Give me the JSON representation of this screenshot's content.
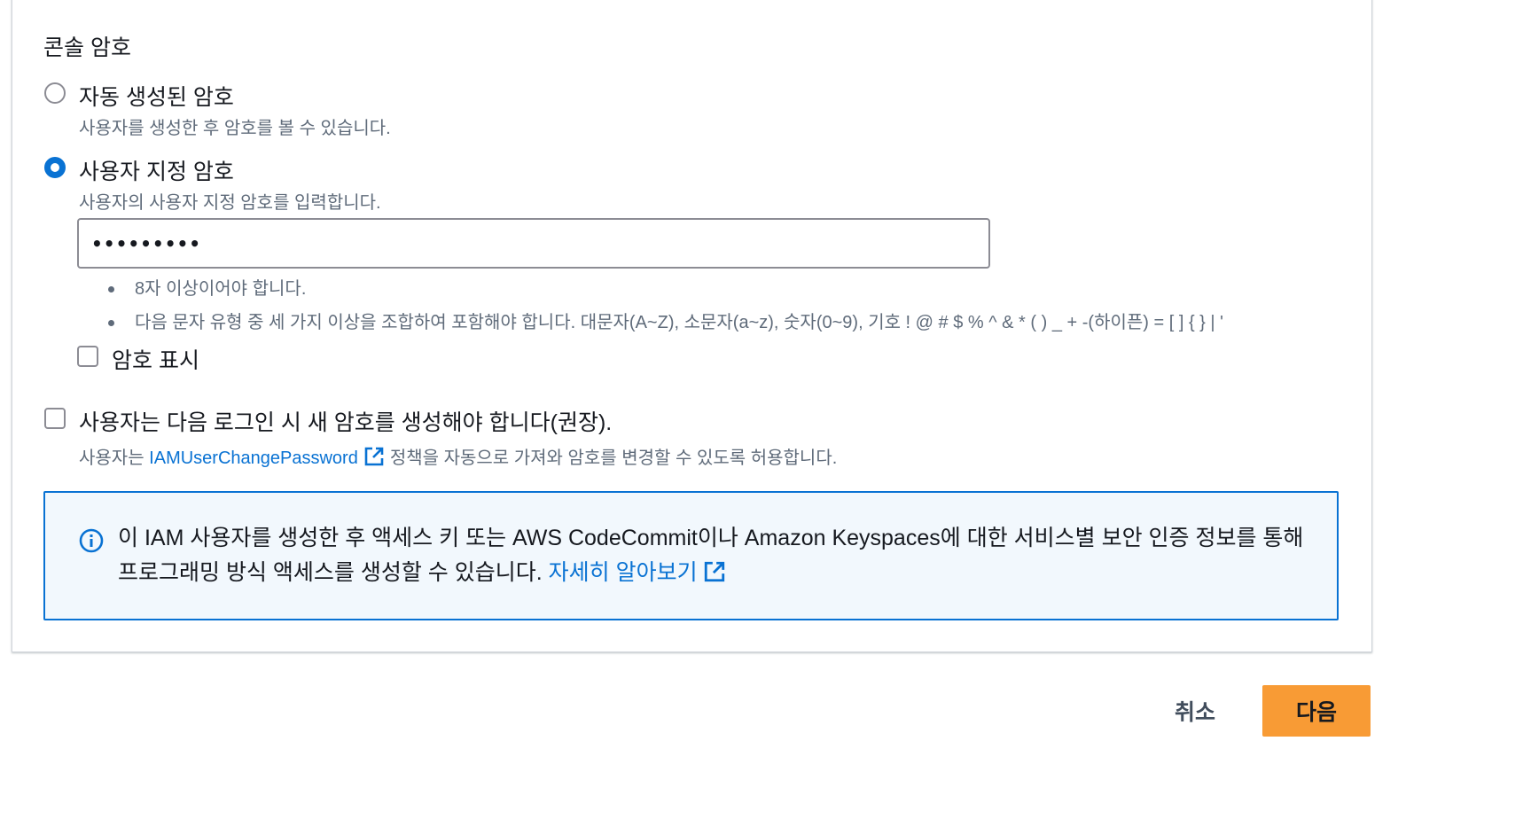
{
  "console_password": {
    "section_title": "콘솔 암호",
    "options": [
      {
        "label": "자동 생성된 암호",
        "description": "사용자를 생성한 후 암호를 볼 수 있습니다.",
        "selected": false
      },
      {
        "label": "사용자 지정 암호",
        "description": "사용자의 사용자 지정 암호를 입력합니다.",
        "selected": true
      }
    ],
    "password_value": "•••••••••",
    "rules": [
      "8자 이상이어야 합니다.",
      "다음 문자 유형 중 세 가지 이상을 조합하여 포함해야 합니다. 대문자(A~Z), 소문자(a~z), 숫자(0~9), 기호 ! @ # $ % ^ & * ( ) _ + -(하이픈) = [ ] { } | '"
    ],
    "show_password_label": "암호 표시",
    "show_password_checked": false,
    "require_reset": {
      "label": "사용자는 다음 로그인 시 새 암호를 생성해야 합니다(권장).",
      "checked": false,
      "desc_prefix": "사용자는",
      "policy_link": "IAMUserChangePassword",
      "desc_suffix": "정책을 자동으로 가져와 암호를 변경할 수 있도록 허용합니다."
    }
  },
  "info": {
    "text": "이 IAM 사용자를 생성한 후 액세스 키 또는 AWS CodeCommit이나 Amazon Keyspaces에 대한 서비스별 보안 인증 정보를 통해 프로그래밍 방식 액세스를 생성할 수 있습니다.",
    "learn_more": "자세히 알아보기"
  },
  "actions": {
    "cancel": "취소",
    "next": "다음"
  },
  "colors": {
    "accent": "#0972d3",
    "primary_button": "#f89b35",
    "info_background": "#f2f8fd"
  },
  "icons": {
    "external_link": "external-link-icon",
    "info": "info-icon"
  }
}
